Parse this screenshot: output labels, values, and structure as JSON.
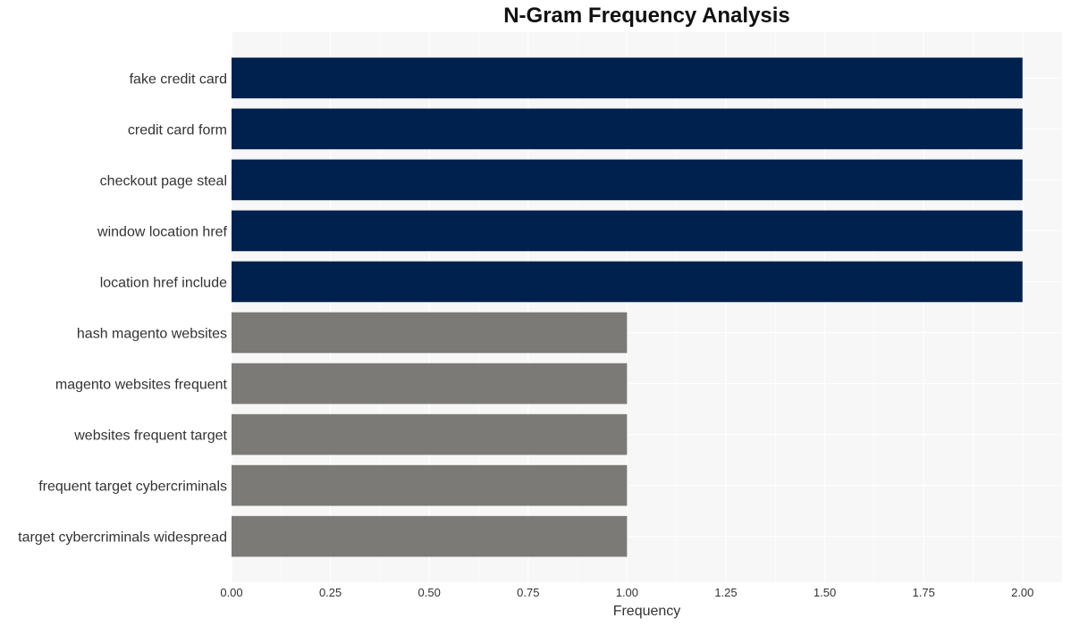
{
  "chart_data": {
    "type": "bar",
    "orientation": "horizontal",
    "title": "N-Gram Frequency Analysis",
    "xlabel": "Frequency",
    "ylabel": "",
    "xlim": [
      0,
      2.1
    ],
    "xticks": [
      0,
      0.25,
      0.5,
      0.75,
      1.0,
      1.25,
      1.5,
      1.75,
      2.0
    ],
    "xtick_labels": [
      "0.00",
      "0.25",
      "0.50",
      "0.75",
      "1.00",
      "1.25",
      "1.50",
      "1.75",
      "2.00"
    ],
    "grid": true,
    "categories": [
      "fake credit card",
      "credit card form",
      "checkout page steal",
      "window location href",
      "location href include",
      "hash magento websites",
      "magento websites frequent",
      "websites frequent target",
      "frequent target cybercriminals",
      "target cybercriminals widespread"
    ],
    "values": [
      2,
      2,
      2,
      2,
      2,
      1,
      1,
      1,
      1,
      1
    ],
    "colors": [
      "#00214d",
      "#00214d",
      "#00214d",
      "#00214d",
      "#00214d",
      "#7b7a76",
      "#7b7a76",
      "#7b7a76",
      "#7b7a76",
      "#7b7a76"
    ],
    "background": "#f7f7f7"
  }
}
